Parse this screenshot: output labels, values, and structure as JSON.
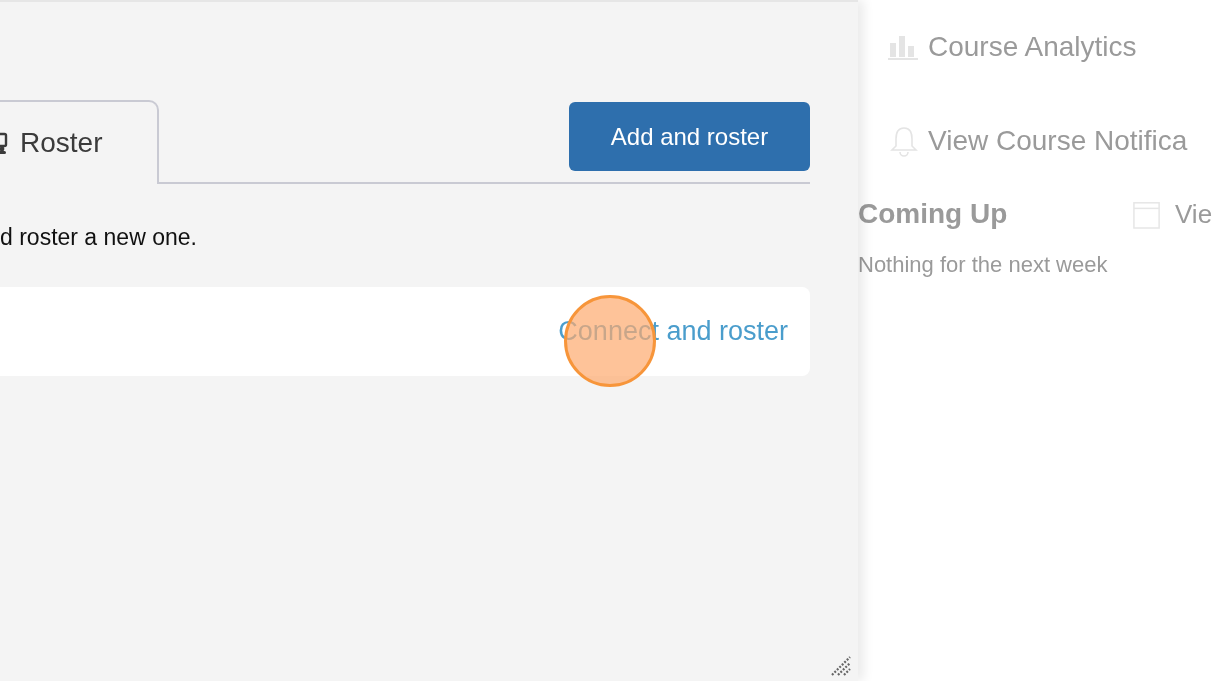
{
  "tabs": [
    {
      "label": "Roster",
      "selected": true
    }
  ],
  "add_button": "Add and roster",
  "description": "d roster a new one.",
  "connect_link": "Connect and roster",
  "sidebar": {
    "actions": [
      {
        "label": "Course Analytics",
        "kind": "analytics"
      },
      {
        "label": "View Course Notifica",
        "kind": "notifications"
      }
    ],
    "coming_up": {
      "title": "Coming Up",
      "link": "Vie",
      "empty_text": "Nothing for the next week"
    }
  }
}
